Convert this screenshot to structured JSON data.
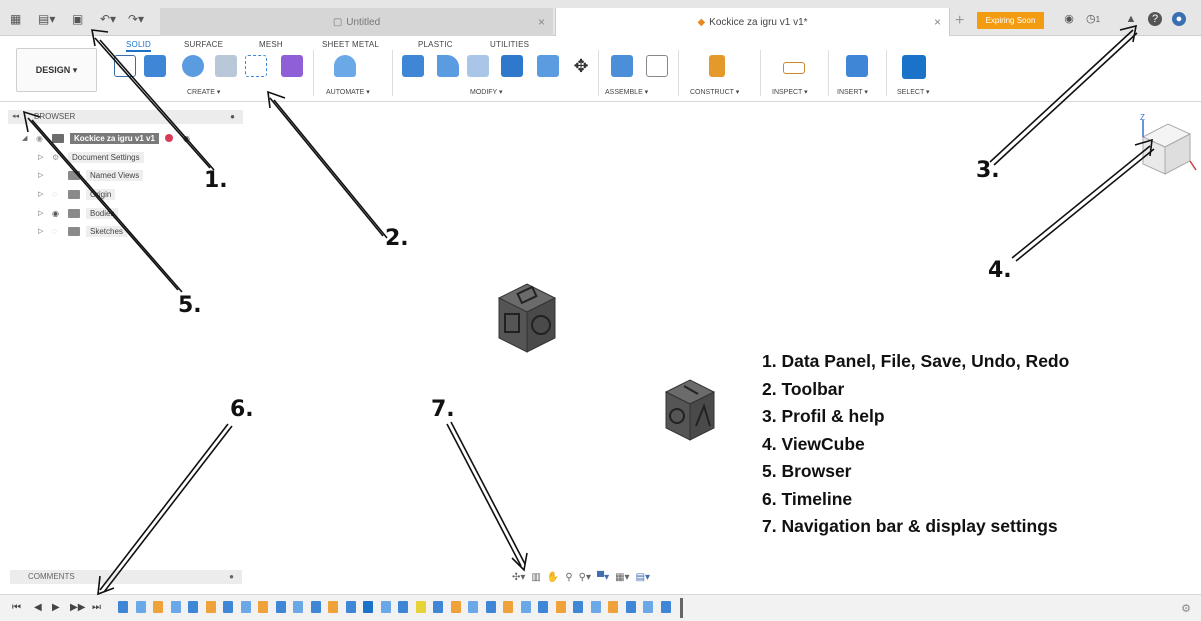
{
  "titlebar": {
    "tabs": [
      {
        "label": "Untitled"
      },
      {
        "label": "Kockice za igru v1 v1*"
      }
    ],
    "expiring_label": "Expiring Soon",
    "notification_count": "1"
  },
  "ribbon": {
    "tabs": [
      "SOLID",
      "SURFACE",
      "MESH",
      "SHEET METAL",
      "PLASTIC",
      "UTILITIES"
    ],
    "workspace_label": "DESIGN ▾",
    "groups": [
      "CREATE ▾",
      "AUTOMATE ▾",
      "MODIFY ▾",
      "ASSEMBLE ▾",
      "CONSTRUCT ▾",
      "INSPECT ▾",
      "INSERT ▾",
      "SELECT ▾"
    ]
  },
  "browser": {
    "title": "BROWSER",
    "root": "Kockice za igru v1 v1",
    "items": [
      "Document Settings",
      "Named Views",
      "Origin",
      "Bodies",
      "Sketches"
    ]
  },
  "comments": {
    "title": "COMMENTS"
  },
  "annotations": {
    "numbers": [
      "1.",
      "2.",
      "3.",
      "4.",
      "5.",
      "6.",
      "7."
    ],
    "legend": [
      "1. Data Panel, File, Save, Undo, Redo",
      "2. Toolbar",
      "3. Profil & help",
      "4. ViewCube",
      "5. Browser",
      "6. Timeline",
      "7. Navigation bar & display settings"
    ]
  },
  "icons": {
    "grid": "grid-icon",
    "file": "file-icon",
    "save": "save-icon",
    "undo": "undo-icon",
    "redo": "redo-icon",
    "help": "help-icon",
    "profile": "profile-icon",
    "bell": "bell-icon",
    "settings": "gear-icon"
  },
  "colors": {
    "accent": "#1a73c8",
    "expiring": "#f39c12"
  }
}
